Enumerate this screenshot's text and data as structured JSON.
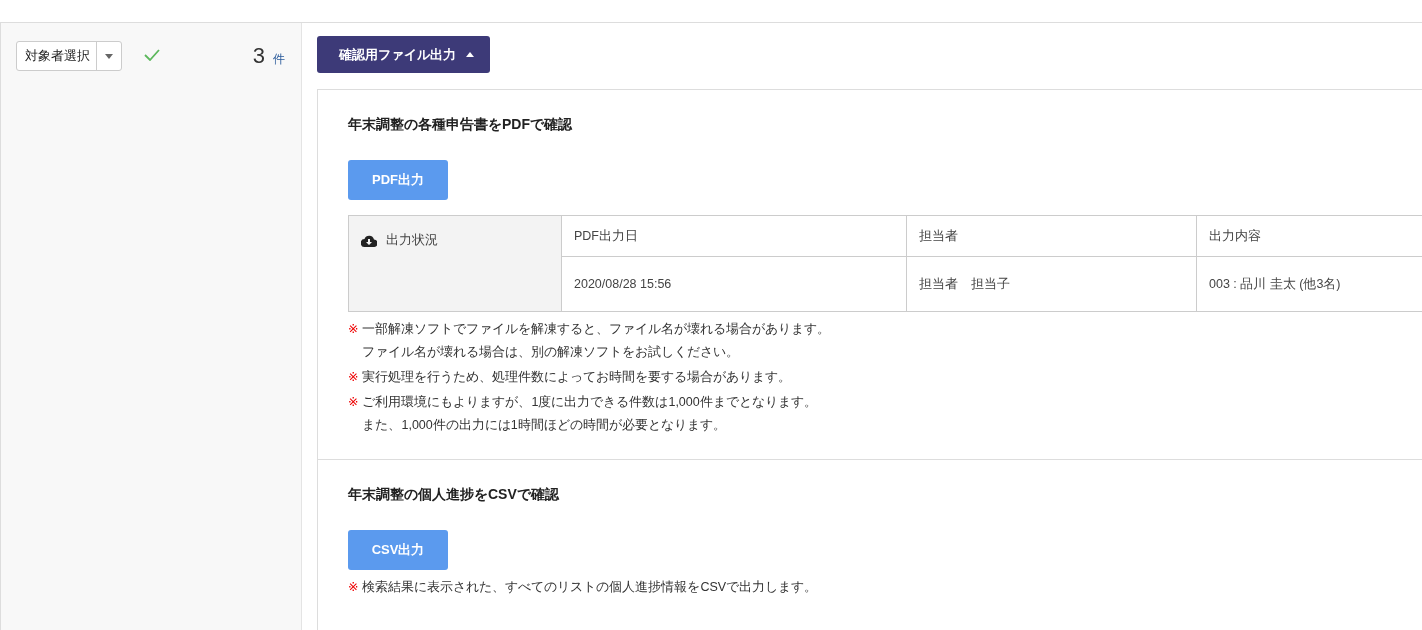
{
  "sidebar": {
    "selector": {
      "label": "対象者選択"
    },
    "count": "3",
    "count_unit": "件"
  },
  "output_toggle": {
    "label": "確認用ファイル出力",
    "expanded": true
  },
  "sections": [
    {
      "title": "年末調整の各種申告書をPDFで確認",
      "button": "PDF出力",
      "status_table": {
        "label": "出力状況",
        "columns": [
          "PDF出力日",
          "担当者",
          "出力内容"
        ],
        "rows": [
          [
            "2020/08/28 15:56",
            "担当者　担当子",
            "003 : 品川 圭太 (他3名)"
          ]
        ]
      },
      "notes": [
        {
          "mark": "※",
          "lines": [
            "一部解凍ソフトでファイルを解凍すると、ファイル名が壊れる場合があります。",
            "ファイル名が壊れる場合は、別の解凍ソフトをお試しください。"
          ]
        },
        {
          "mark": "※",
          "lines": [
            "実行処理を行うため、処理件数によってお時間を要する場合があります。"
          ]
        },
        {
          "mark": "※",
          "lines": [
            "ご利用環境にもよりますが、1度に出力できる件数は1,000件までとなります。",
            "また、1,000件の出力には1時間ほどの時間が必要となります。"
          ]
        }
      ]
    },
    {
      "title": "年末調整の個人進捗をCSVで確認",
      "button": "CSV出力",
      "notes": [
        {
          "mark": "※",
          "lines": [
            "検索結果に表示された、すべてのリストの個人進捗情報をCSVで出力します。"
          ]
        }
      ]
    }
  ]
}
